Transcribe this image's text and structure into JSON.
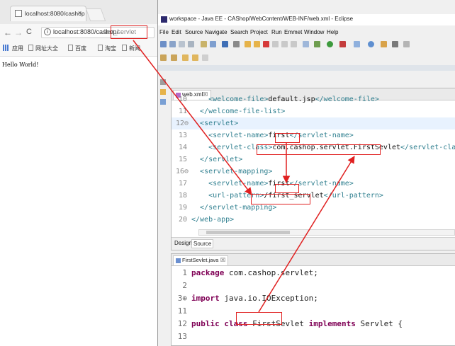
{
  "browser": {
    "tab_title": "localhost:8080/cashop",
    "tab_close": "×",
    "nav": {
      "back": "←",
      "forward": "→",
      "reload": "C"
    },
    "url_host": "localhost:8080/cashop/",
    "url_path": "first_servlet",
    "bookmarks": [
      "应用",
      "网址大全",
      "百度",
      "淘宝",
      "新闻"
    ],
    "page_text": "Hello World!"
  },
  "eclipse": {
    "window_title": "workspace - Java EE - CAShop/WebContent/WEB-INF/web.xml - Eclipse",
    "menu": [
      "File",
      "Edit",
      "Source",
      "Navigate",
      "Search",
      "Project",
      "Run",
      "Emmet",
      "Window",
      "Help"
    ],
    "xml_tab": {
      "label": "web.xml",
      "close": "☒"
    },
    "xml_lines": [
      {
        "n": "10",
        "code": "    <welcome-file>default.jsp</welcome-file>"
      },
      {
        "n": "11",
        "code": "  </welcome-file-list>"
      },
      {
        "n": "12⊖",
        "code": "  <servlet>"
      },
      {
        "n": "13",
        "code": "    <servlet-name>first</servlet-name>"
      },
      {
        "n": "14",
        "code": "    <servlet-class>com.cashop.servlet.FirstSevlet</servlet-class>"
      },
      {
        "n": "15",
        "code": "  </servlet>"
      },
      {
        "n": "16⊖",
        "code": "  <servlet-mapping>"
      },
      {
        "n": "17",
        "code": "    <servlet-name>first</servlet-name>"
      },
      {
        "n": "18",
        "code": "    <url-pattern>/first_servlet</url-pattern>"
      },
      {
        "n": "19",
        "code": "  </servlet-mapping>"
      },
      {
        "n": "20",
        "code": "</web-app>"
      }
    ],
    "xml_bottom_tabs": [
      "Design",
      "Source"
    ],
    "java_tab": {
      "label": "FirstSevlet.java",
      "close": "☒"
    },
    "java_lines": [
      {
        "n": "1",
        "code": "package com.cashop.servlet;"
      },
      {
        "n": "2",
        "code": ""
      },
      {
        "n": "3⊕",
        "code": "import java.io.IOException;"
      },
      {
        "n": "11",
        "code": ""
      },
      {
        "n": "12",
        "code": "public class FirstSevlet implements Servlet {"
      },
      {
        "n": "13",
        "code": ""
      }
    ]
  },
  "annotation_color": "#e02020"
}
